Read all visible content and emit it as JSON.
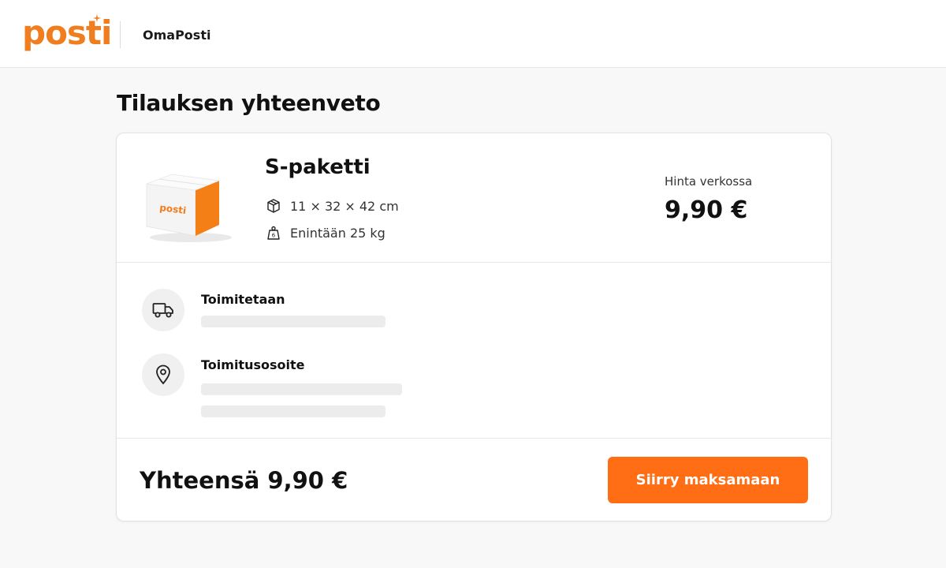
{
  "header": {
    "logo_text": "posti",
    "app_name": "OmaPosti"
  },
  "page": {
    "title": "Tilauksen yhteenveto"
  },
  "product": {
    "image_label": "posti",
    "name": "S-paketti",
    "dimensions": "11 × 32 × 42 cm",
    "dimensions_icon": "box-icon",
    "weight": "Enintään 25 kg",
    "weight_icon": "weight-icon",
    "price_label": "Hinta verkossa",
    "price": "9,90 €"
  },
  "delivery": {
    "delivered_title": "Toimitetaan",
    "delivered_icon": "truck-icon",
    "address_title": "Toimitusosoite",
    "address_icon": "location-pin-icon"
  },
  "footer": {
    "total": "Yhteensä 9,90 €",
    "pay_button": "Siirry maksamaan"
  },
  "colors": {
    "brand_orange": "#f07d1e",
    "button_orange": "#ff6e14",
    "skeleton": "#ececec",
    "icon_circle": "#f0f0f0"
  }
}
